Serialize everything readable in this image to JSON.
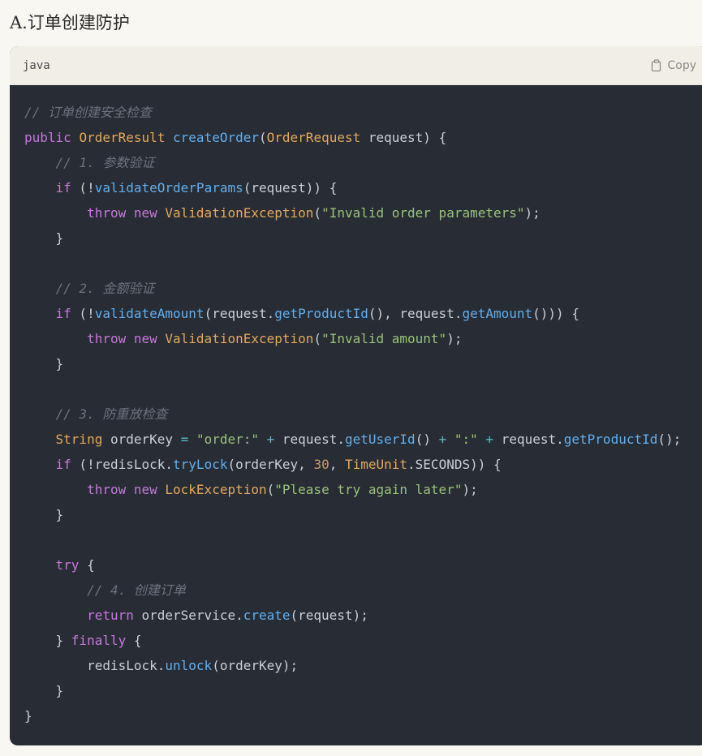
{
  "heading": "A.订单创建防护",
  "code_block": {
    "language": "java",
    "copy_label": "Copy",
    "lines": [
      [
        {
          "t": "// 订单创建安全检查",
          "c": "cm"
        }
      ],
      [
        {
          "t": "public ",
          "c": "kw"
        },
        {
          "t": "OrderResult ",
          "c": "ty"
        },
        {
          "t": "createOrder",
          "c": "fn"
        },
        {
          "t": "(",
          "c": "pl"
        },
        {
          "t": "OrderRequest",
          "c": "ty"
        },
        {
          "t": " request) {",
          "c": "pl"
        }
      ],
      [
        {
          "t": "    ",
          "c": "pl"
        },
        {
          "t": "// 1. 参数验证",
          "c": "cm"
        }
      ],
      [
        {
          "t": "    ",
          "c": "pl"
        },
        {
          "t": "if",
          "c": "kw"
        },
        {
          "t": " (!",
          "c": "pl"
        },
        {
          "t": "validateOrderParams",
          "c": "fn"
        },
        {
          "t": "(request)) {",
          "c": "pl"
        }
      ],
      [
        {
          "t": "        ",
          "c": "pl"
        },
        {
          "t": "throw new ",
          "c": "kw"
        },
        {
          "t": "ValidationException",
          "c": "ty"
        },
        {
          "t": "(",
          "c": "pl"
        },
        {
          "t": "\"Invalid order parameters\"",
          "c": "st"
        },
        {
          "t": ");",
          "c": "pl"
        }
      ],
      [
        {
          "t": "    }",
          "c": "pl"
        }
      ],
      [],
      [
        {
          "t": "    ",
          "c": "pl"
        },
        {
          "t": "// 2. 金额验证",
          "c": "cm"
        }
      ],
      [
        {
          "t": "    ",
          "c": "pl"
        },
        {
          "t": "if",
          "c": "kw"
        },
        {
          "t": " (!",
          "c": "pl"
        },
        {
          "t": "validateAmount",
          "c": "fn"
        },
        {
          "t": "(request.",
          "c": "pl"
        },
        {
          "t": "getProductId",
          "c": "fn"
        },
        {
          "t": "(), request.",
          "c": "pl"
        },
        {
          "t": "getAmount",
          "c": "fn"
        },
        {
          "t": "())) {",
          "c": "pl"
        }
      ],
      [
        {
          "t": "        ",
          "c": "pl"
        },
        {
          "t": "throw new ",
          "c": "kw"
        },
        {
          "t": "ValidationException",
          "c": "ty"
        },
        {
          "t": "(",
          "c": "pl"
        },
        {
          "t": "\"Invalid amount\"",
          "c": "st"
        },
        {
          "t": ");",
          "c": "pl"
        }
      ],
      [
        {
          "t": "    }",
          "c": "pl"
        }
      ],
      [],
      [
        {
          "t": "    ",
          "c": "pl"
        },
        {
          "t": "// 3. 防重放检查",
          "c": "cm"
        }
      ],
      [
        {
          "t": "    ",
          "c": "pl"
        },
        {
          "t": "String",
          "c": "ty"
        },
        {
          "t": " orderKey ",
          "c": "pl"
        },
        {
          "t": "=",
          "c": "op"
        },
        {
          "t": " ",
          "c": "pl"
        },
        {
          "t": "\"order:\"",
          "c": "st"
        },
        {
          "t": " ",
          "c": "pl"
        },
        {
          "t": "+",
          "c": "op"
        },
        {
          "t": " request.",
          "c": "pl"
        },
        {
          "t": "getUserId",
          "c": "fn"
        },
        {
          "t": "() ",
          "c": "pl"
        },
        {
          "t": "+",
          "c": "op"
        },
        {
          "t": " ",
          "c": "pl"
        },
        {
          "t": "\":\"",
          "c": "st"
        },
        {
          "t": " ",
          "c": "pl"
        },
        {
          "t": "+",
          "c": "op"
        },
        {
          "t": " request.",
          "c": "pl"
        },
        {
          "t": "getProductId",
          "c": "fn"
        },
        {
          "t": "();",
          "c": "pl"
        }
      ],
      [
        {
          "t": "    ",
          "c": "pl"
        },
        {
          "t": "if",
          "c": "kw"
        },
        {
          "t": " (!redisLock.",
          "c": "pl"
        },
        {
          "t": "tryLock",
          "c": "fn"
        },
        {
          "t": "(orderKey, ",
          "c": "pl"
        },
        {
          "t": "30",
          "c": "nm"
        },
        {
          "t": ", ",
          "c": "pl"
        },
        {
          "t": "TimeUnit",
          "c": "ty"
        },
        {
          "t": ".SECONDS)) {",
          "c": "pl"
        }
      ],
      [
        {
          "t": "        ",
          "c": "pl"
        },
        {
          "t": "throw new ",
          "c": "kw"
        },
        {
          "t": "LockException",
          "c": "ty"
        },
        {
          "t": "(",
          "c": "pl"
        },
        {
          "t": "\"Please try again later\"",
          "c": "st"
        },
        {
          "t": ");",
          "c": "pl"
        }
      ],
      [
        {
          "t": "    }",
          "c": "pl"
        }
      ],
      [],
      [
        {
          "t": "    ",
          "c": "pl"
        },
        {
          "t": "try",
          "c": "kw"
        },
        {
          "t": " {",
          "c": "pl"
        }
      ],
      [
        {
          "t": "        ",
          "c": "pl"
        },
        {
          "t": "// 4. 创建订单",
          "c": "cm"
        }
      ],
      [
        {
          "t": "        ",
          "c": "pl"
        },
        {
          "t": "return",
          "c": "kw"
        },
        {
          "t": " orderService.",
          "c": "pl"
        },
        {
          "t": "create",
          "c": "fn"
        },
        {
          "t": "(request);",
          "c": "pl"
        }
      ],
      [
        {
          "t": "    } ",
          "c": "pl"
        },
        {
          "t": "finally",
          "c": "kw"
        },
        {
          "t": " {",
          "c": "pl"
        }
      ],
      [
        {
          "t": "        redisLock.",
          "c": "pl"
        },
        {
          "t": "unlock",
          "c": "fn"
        },
        {
          "t": "(orderKey);",
          "c": "pl"
        }
      ],
      [
        {
          "t": "    }",
          "c": "pl"
        }
      ],
      [
        {
          "t": "}",
          "c": "pl"
        }
      ]
    ]
  }
}
